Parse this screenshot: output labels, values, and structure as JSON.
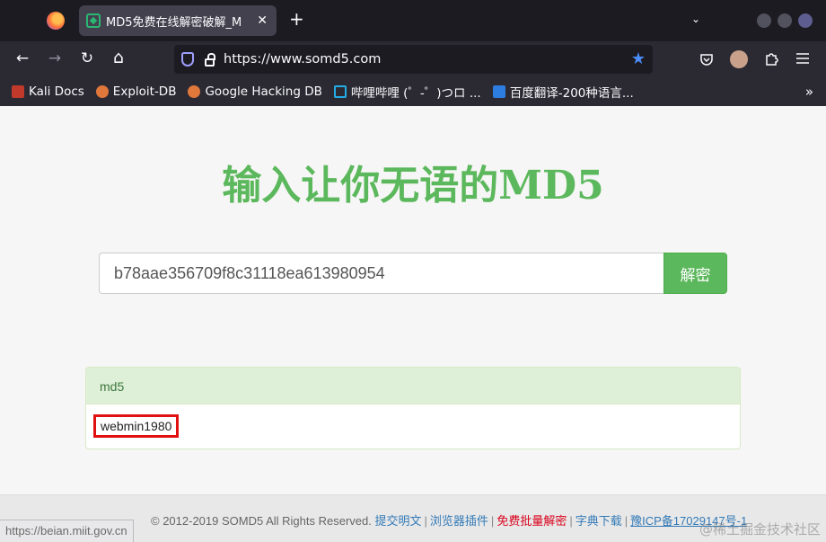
{
  "browser": {
    "tab": {
      "title": "MD5免费在线解密破解_M",
      "close": "✕"
    },
    "new_tab": "+",
    "tab_list": "⌄",
    "nav": {
      "back": "←",
      "forward": "→",
      "reload": "↻",
      "home": "⌂"
    },
    "url": "https://www.somd5.com",
    "bookmarks": [
      {
        "label": "Kali Docs",
        "icon": "kali-docs-icon",
        "color": "#c0392b"
      },
      {
        "label": "Exploit-DB",
        "icon": "exploit-db-icon",
        "color": "#e0773b"
      },
      {
        "label": "Google Hacking DB",
        "icon": "ghdb-icon",
        "color": "#e0773b"
      },
      {
        "label": "哔哩哔哩 (゜-゜)つロ ...",
        "icon": "bilibili-icon",
        "color": "#23ade5"
      },
      {
        "label": "百度翻译-200种语言...",
        "icon": "baidu-translate-icon",
        "color": "#2d7de0"
      }
    ],
    "bookmarks_more": "»"
  },
  "page": {
    "headline": "输入让你无语的MD5",
    "search": {
      "value": "b78aae356709f8c31118ea613980954",
      "button": "解密"
    },
    "panel": {
      "heading": "md5",
      "result": "webmin1980"
    },
    "footer": {
      "copyright": "© 2012-2019 SOMD5 All Rights Reserved.",
      "links": [
        "提交明文",
        "浏览器插件",
        "免费批量解密",
        "字典下载",
        "豫ICP备17029147号-1"
      ]
    },
    "status_url": "https://beian.miit.gov.cn",
    "watermark": "@稀土掘金技术社区"
  },
  "colors": {
    "accent_green": "#5cb85c",
    "panel_green": "#dff0d8",
    "highlight_red": "#e01010",
    "link_blue": "#337ab7"
  }
}
